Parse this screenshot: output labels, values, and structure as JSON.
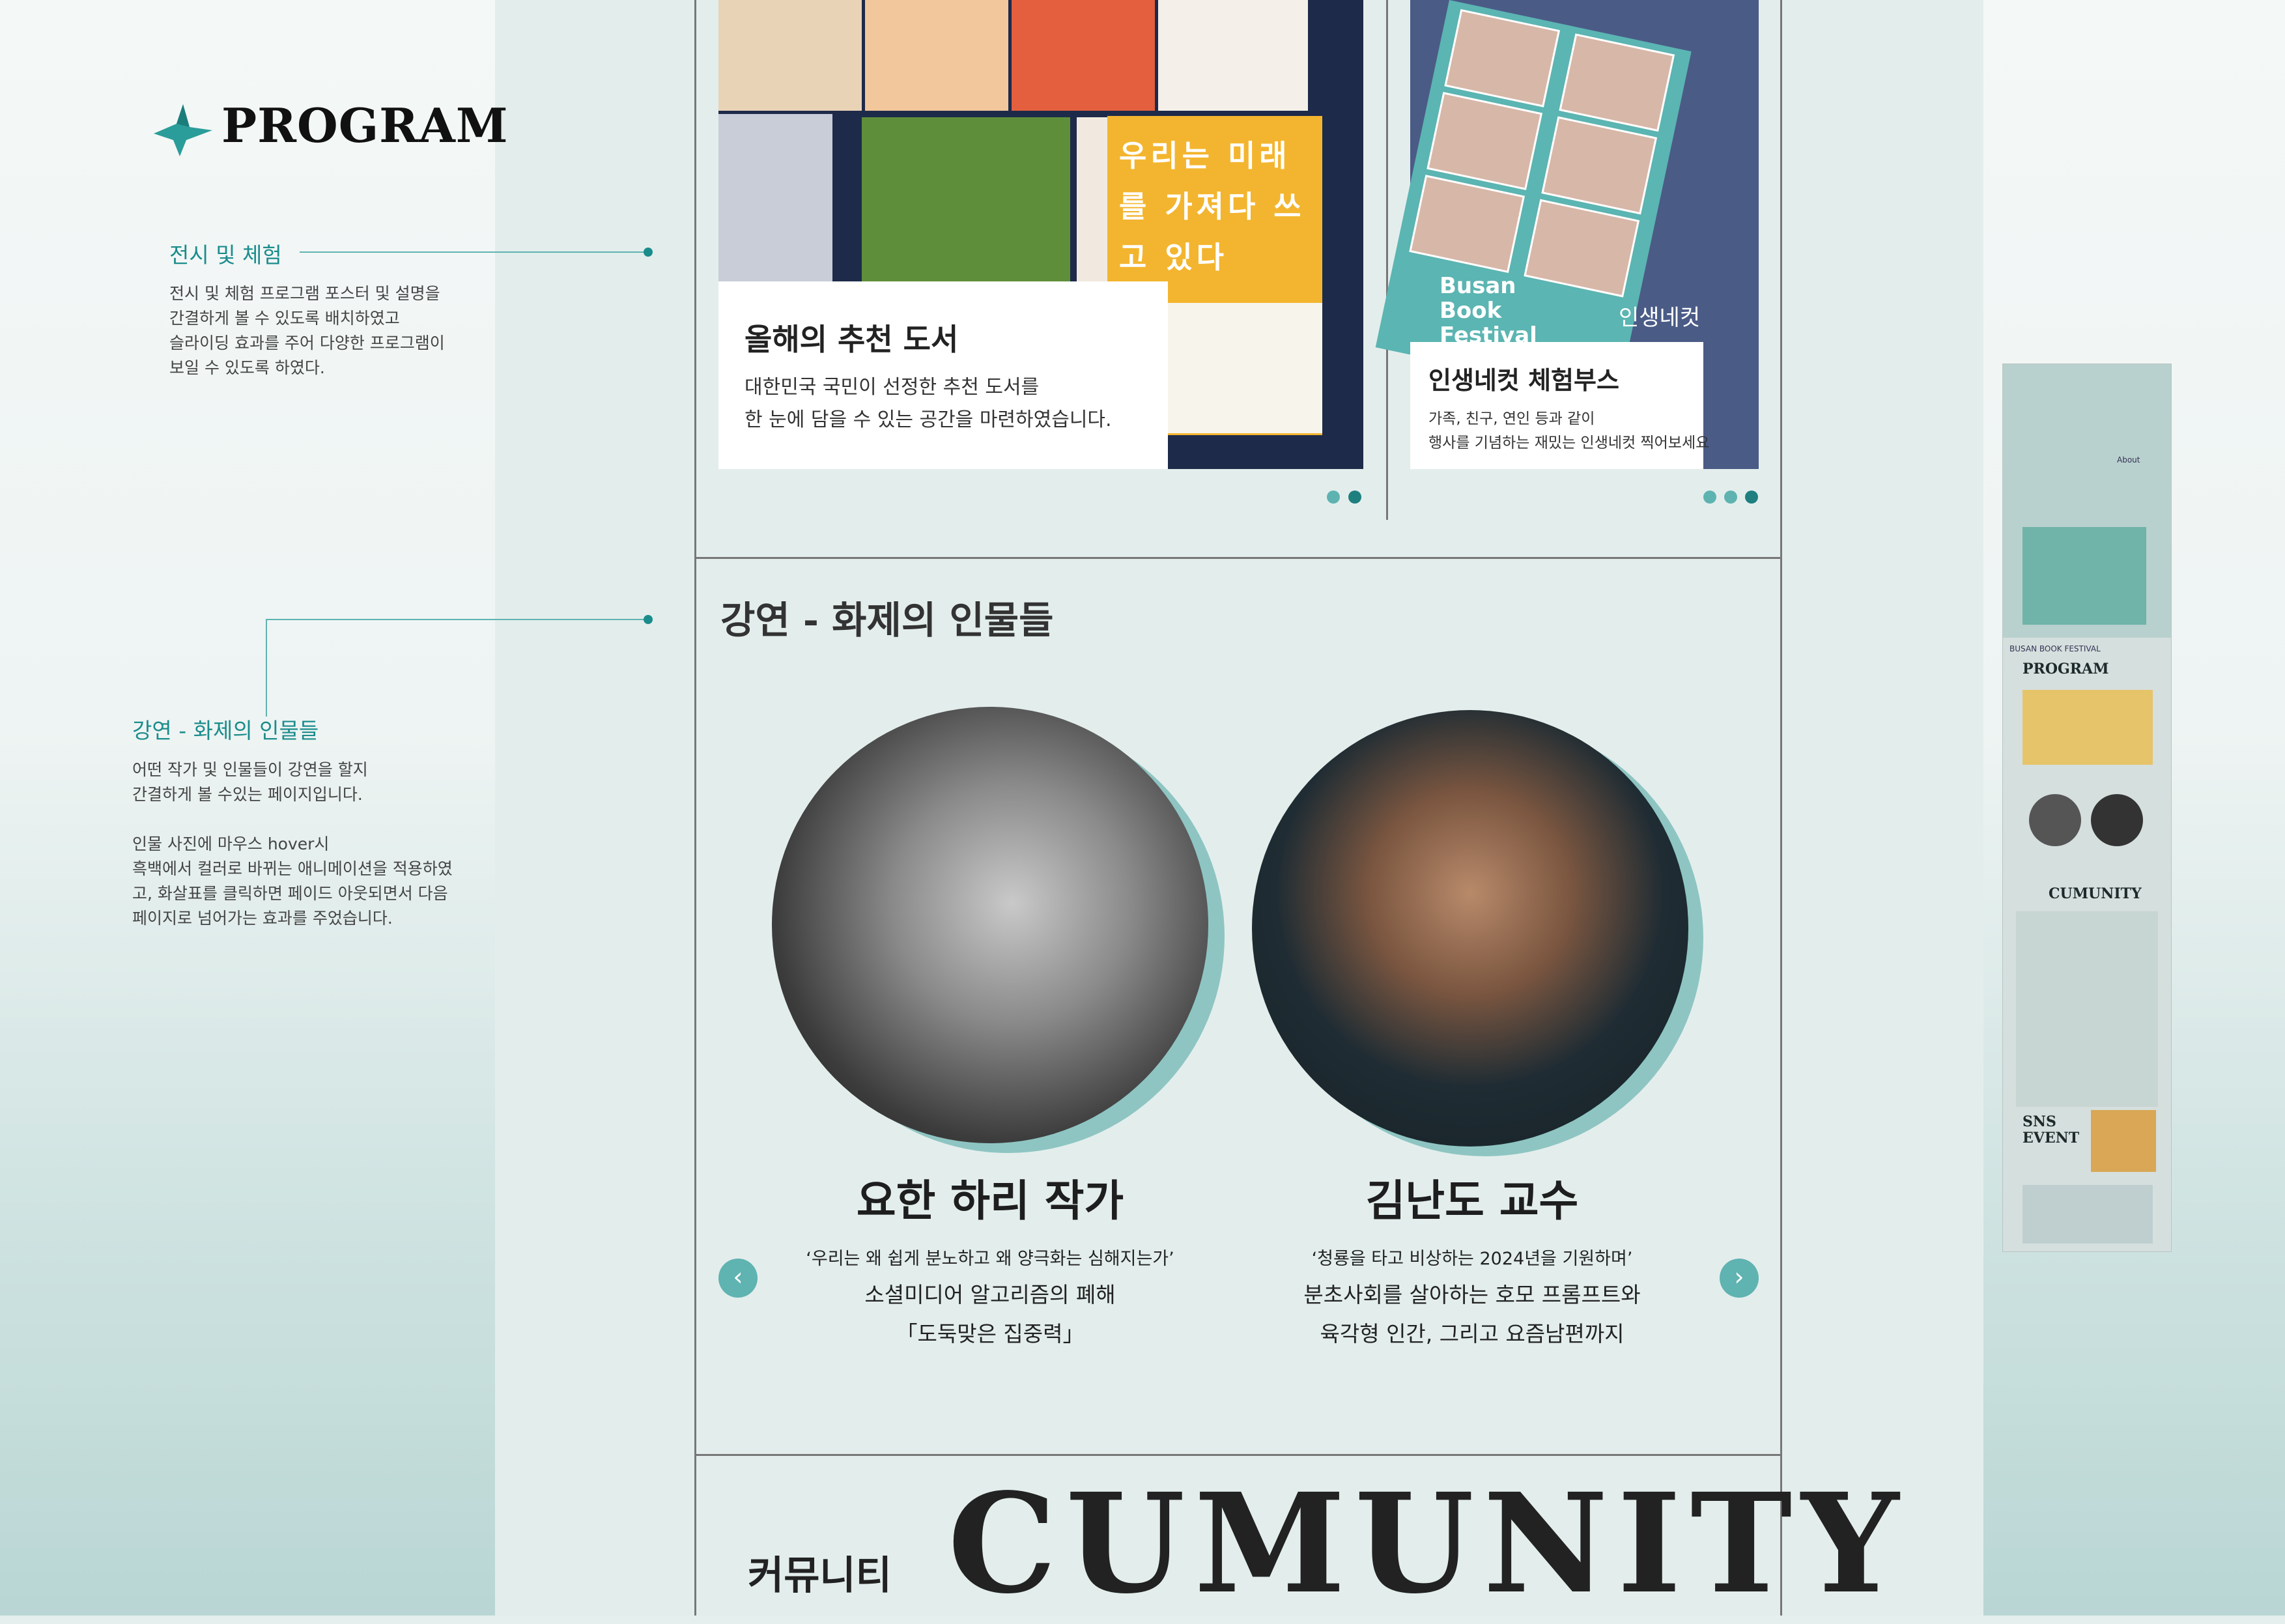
{
  "program": {
    "title": "PROGRAM"
  },
  "annotations": {
    "exhibition": {
      "heading": "전시 및 체험",
      "lines": [
        "전시 및 체험 프로그램 포스터 및 설명을",
        "간결하게 볼 수 있도록 배치하였고",
        "슬라이딩 효과를 주어 다양한 프로그램이",
        "보일 수 있도록 하였다."
      ]
    },
    "lecture": {
      "heading": "강연 - 화제의 인물들",
      "lines": [
        "어떤 작가 및 인물들이 강연을 할지",
        "간결하게 볼 수있는 페이지입니다.",
        "",
        "인물 사진에 마우스 hover시",
        "흑백에서 컬러로 바뀌는 애니메이션을 적용하였",
        "고, 화살표를 클릭하면 페이드 아웃되면서 다음",
        "페이지로 넘어가는 효과를 주었습니다."
      ]
    }
  },
  "cards": {
    "books": {
      "title": "올해의 추천 도서",
      "desc_lines": [
        "대한민국 국민이 선정한 추천 도서를",
        "한 눈에 담을 수 있는 공간을 마련하였습니다."
      ],
      "book_title": "우리는 미래를 가져다 쓰고 있다"
    },
    "photobooth": {
      "title": "인생네컷 체험부스",
      "desc_lines": [
        "가족, 친구, 연인 등과 같이",
        "행사를 기념하는 재밌는 인생네컷 찍어보세요"
      ],
      "poster_text": "Busan Book Festival",
      "poster_caption": "인생네컷"
    }
  },
  "lecture": {
    "title": "강연 - 화제의 인물들",
    "people": [
      {
        "name": "요한 하리 작가",
        "quote": "‘우리는 왜 쉽게 분노하고 왜 양극화는 심해지는가’",
        "line1": "소셜미디어 알고리즘의 폐해",
        "line2": "「도둑맞은 집중력」"
      },
      {
        "name": "김난도 교수",
        "quote": "‘청룡을 타고 비상하는 2024년을 기원하며’",
        "line1": "분초사회를 살아하는 호모 프롬프트와",
        "line2": "육각형 인간, 그리고 요즘남편까지"
      }
    ],
    "prev": "‹",
    "next": "›"
  },
  "community": {
    "korean": "커뮤니티",
    "english": "CUMUNITY"
  },
  "thumbnail": {
    "program": "PROGRAM",
    "cumunity": "CUMUNITY",
    "sns": "SNS",
    "event": "EVENT",
    "about": "About",
    "festival": "BUSAN BOOK FESTIVAL"
  },
  "colors": {
    "accent": "#1b8c8c",
    "accent_light": "#5fb3b1",
    "background": "#e3eeec"
  }
}
